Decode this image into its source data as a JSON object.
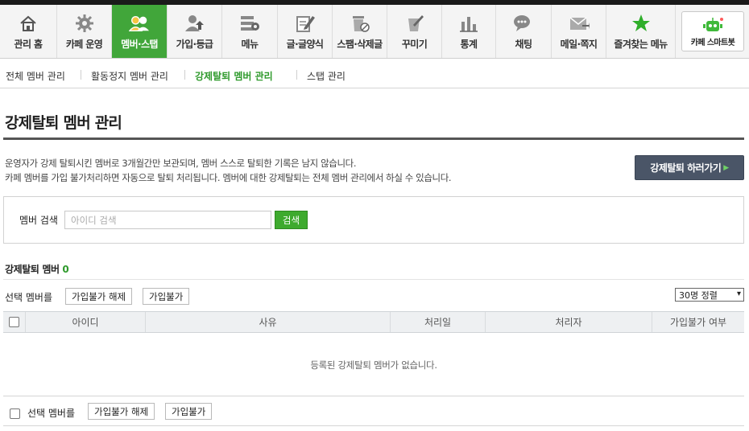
{
  "gnb": {
    "items": [
      {
        "label": "관리 홈",
        "icon": "home-icon"
      },
      {
        "label": "카페 운영",
        "icon": "gear-icon"
      },
      {
        "label": "멤버·스탭",
        "icon": "members-icon"
      },
      {
        "label": "가입·등급",
        "icon": "member-upgrade-icon"
      },
      {
        "label": "메뉴",
        "icon": "menu-settings-icon"
      },
      {
        "label": "글·글양식",
        "icon": "pencil-doc-icon"
      },
      {
        "label": "스팸·삭제글",
        "icon": "trash-icon"
      },
      {
        "label": "꾸미기",
        "icon": "paint-brush-icon"
      },
      {
        "label": "통계",
        "icon": "bar-chart-icon"
      },
      {
        "label": "채팅",
        "icon": "chat-bubble-icon"
      },
      {
        "label": "메일·쪽지",
        "icon": "mail-icon"
      },
      {
        "label": "즐겨찾는 메뉴",
        "icon": "star-icon"
      }
    ],
    "active_index": 2,
    "active_color": "#41a63a",
    "smartbot": {
      "label": "카페 스마트봇",
      "icon": "robot-icon"
    }
  },
  "lnb": {
    "items": [
      {
        "label": "전체 멤버 관리"
      },
      {
        "label": "활동정지 멤버 관리"
      },
      {
        "label": "강제탈퇴 멤버 관리"
      },
      {
        "label": "스탭 관리"
      }
    ],
    "active_index": 2
  },
  "page": {
    "title": "강제탈퇴 멤버 관리",
    "notice_1": "운영자가 강제 탈퇴시킨 멤버로 3개월간만 보관되며, 멤버 스스로 탈퇴한 기록은 남지 않습니다.",
    "notice_2": "카페 멤버를 가입 불가처리하면 자동으로 탈퇴 처리됩니다. 멤버에 대한 강제탈퇴는 전체 멤버 관리에서 하실 수 있습니다.",
    "go_button": "강제탈퇴 하러가기"
  },
  "search": {
    "label": "멤버 검색",
    "placeholder": "아이디 검색",
    "value": "",
    "button": "검색"
  },
  "list": {
    "count_label": "강제탈퇴 멤버",
    "count": "0",
    "select_label": "선택 멤버를",
    "btn_unban": "가입불가 해제",
    "btn_ban": "가입불가",
    "sort": "30명 정렬",
    "columns": [
      "아이디",
      "사유",
      "처리일",
      "처리자",
      "가입불가 여부"
    ],
    "empty": "등록된 강제탈퇴 멤버가 없습니다."
  },
  "colors": {
    "accent_green": "#2f9a2c",
    "dark_button": "#4a5567"
  }
}
